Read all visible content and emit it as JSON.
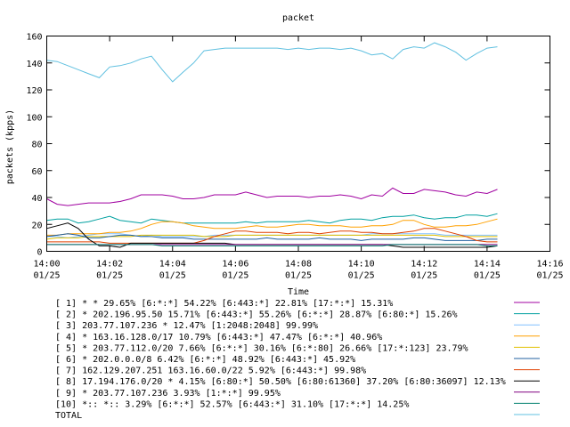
{
  "chart_data": {
    "type": "line",
    "title": "packet",
    "xlabel": "Time",
    "ylabel": "packets (kpps)",
    "ylim": [
      0,
      160
    ],
    "yticks": [
      0,
      20,
      40,
      60,
      80,
      100,
      120,
      140,
      160
    ],
    "xlim": [
      "14:00",
      "14:16"
    ],
    "xticks": [
      {
        "time": "14:00",
        "date": "01/25"
      },
      {
        "time": "14:02",
        "date": "01/25"
      },
      {
        "time": "14:04",
        "date": "01/25"
      },
      {
        "time": "14:06",
        "date": "01/25"
      },
      {
        "time": "14:08",
        "date": "01/25"
      },
      {
        "time": "14:10",
        "date": "01/25"
      },
      {
        "time": "14:12",
        "date": "01/25"
      },
      {
        "time": "14:14",
        "date": "01/25"
      },
      {
        "time": "14:16",
        "date": "01/25"
      }
    ],
    "grid": false,
    "legend_position": "bottom",
    "x_minutes": [
      0.0,
      0.33,
      0.67,
      1.0,
      1.33,
      1.67,
      2.0,
      2.33,
      2.67,
      3.0,
      3.33,
      3.67,
      4.0,
      4.33,
      4.67,
      5.0,
      5.33,
      5.67,
      6.0,
      6.33,
      6.67,
      7.0,
      7.33,
      7.67,
      8.0,
      8.33,
      8.67,
      9.0,
      9.33,
      9.67,
      10.0,
      10.33,
      10.67,
      11.0,
      11.33,
      11.67,
      12.0,
      12.33,
      12.67,
      13.0,
      13.33,
      13.67,
      14.0,
      14.33
    ],
    "series": [
      {
        "name": "[ 1] * * 29.65%  [6:*:*] 54.22% [6:443:*] 22.81% [17:*:*] 15.31%",
        "color": "#a000a0",
        "values": [
          39,
          35,
          34,
          35,
          36,
          36,
          36,
          37,
          39,
          42,
          42,
          42,
          41,
          39,
          39,
          40,
          42,
          42,
          42,
          44,
          42,
          40,
          41,
          41,
          41,
          40,
          41,
          41,
          42,
          41,
          39,
          42,
          41,
          47,
          43,
          43,
          46,
          45,
          44,
          42,
          41,
          44,
          43,
          46
        ]
      },
      {
        "name": "[ 2] * 202.196.95.50 15.71%  [6:443:*] 55.26% [6:*:*] 28.87% [6:80:*] 15.26%",
        "color": "#00a0a0",
        "values": [
          23,
          24,
          24,
          21,
          22,
          24,
          26,
          23,
          22,
          21,
          24,
          23,
          22,
          21,
          21,
          21,
          21,
          21,
          21,
          22,
          21,
          22,
          22,
          22,
          22,
          23,
          22,
          21,
          23,
          24,
          24,
          23,
          25,
          26,
          26,
          27,
          25,
          24,
          25,
          25,
          27,
          27,
          26,
          28
        ]
      },
      {
        "name": "[ 3] 203.77.107.236 * 12.47%  [1:2048:2048] 99.99%",
        "color": "#80c0ff",
        "values": [
          11,
          11,
          10,
          11,
          12,
          13,
          13,
          13,
          12,
          11,
          12,
          11,
          11,
          11,
          11,
          11,
          12,
          12,
          12,
          12,
          12,
          12,
          12,
          12,
          12,
          12,
          12,
          12,
          12,
          12,
          12,
          13,
          13,
          13,
          13,
          13,
          13,
          13,
          12,
          12,
          12,
          12,
          12,
          12
        ]
      },
      {
        "name": "[ 4] * 163.16.128.0/17 10.79%  [6:443:*] 47.47% [6:*:*] 40.96%",
        "color": "#ffa000",
        "values": [
          12,
          12,
          13,
          13,
          13,
          13,
          14,
          14,
          15,
          17,
          20,
          22,
          22,
          21,
          19,
          18,
          17,
          17,
          17,
          18,
          19,
          18,
          18,
          19,
          20,
          20,
          19,
          19,
          19,
          18,
          18,
          19,
          19,
          20,
          23,
          23,
          20,
          18,
          18,
          19,
          19,
          20,
          22,
          24
        ]
      },
      {
        "name": "[ 5] * 203.77.112.0/20 7.66%  [6:*:*] 30.16% [6:*:80] 26.66% [17:*:123] 23.79%",
        "color": "#e0c000",
        "values": [
          9,
          10,
          10,
          10,
          11,
          11,
          11,
          11,
          11,
          12,
          12,
          12,
          12,
          12,
          12,
          11,
          11,
          11,
          12,
          12,
          12,
          12,
          12,
          12,
          12,
          12,
          12,
          12,
          12,
          12,
          12,
          12,
          12,
          12,
          12,
          12,
          12,
          12,
          11,
          11,
          11,
          11,
          11,
          11
        ]
      },
      {
        "name": "[ 6] * 202.0.0.0/8 6.42%  [6:*:*] 48.92% [6:443:*] 45.92%",
        "color": "#2060a0",
        "values": [
          11,
          12,
          13,
          12,
          10,
          10,
          11,
          12,
          12,
          11,
          11,
          10,
          10,
          10,
          9,
          9,
          9,
          9,
          9,
          9,
          9,
          10,
          9,
          9,
          9,
          9,
          10,
          9,
          9,
          9,
          8,
          9,
          9,
          9,
          9,
          10,
          10,
          9,
          8,
          8,
          8,
          8,
          9,
          9
        ]
      },
      {
        "name": "[ 7] 162.129.207.251 163.16.60.0/22 5.92%  [6:443:*] 99.98%",
        "color": "#e04000",
        "values": [
          7,
          7,
          7,
          7,
          7,
          7,
          6,
          6,
          6,
          6,
          6,
          6,
          6,
          6,
          6,
          8,
          11,
          13,
          15,
          15,
          14,
          14,
          14,
          13,
          14,
          14,
          13,
          14,
          15,
          15,
          14,
          14,
          13,
          13,
          14,
          15,
          17,
          17,
          15,
          13,
          11,
          8,
          7,
          7
        ]
      },
      {
        "name": "[ 8] 17.194.176.0/20 * 4.15%  [6:80:*] 50.50% [6:80:61360] 37.20% [6:80:36097] 12.13%",
        "color": "#000000",
        "values": [
          17,
          19,
          21,
          17,
          9,
          4,
          4,
          3,
          6,
          6,
          6,
          6,
          6,
          6,
          6,
          6,
          6,
          6,
          5,
          5,
          5,
          5,
          5,
          5,
          5,
          5,
          5,
          5,
          5,
          5,
          5,
          5,
          5,
          4,
          3,
          3,
          3,
          3,
          3,
          3,
          3,
          3,
          3,
          4
        ]
      },
      {
        "name": "[ 9] * 203.77.107.236 3.93%  [1:*:*] 99.95%",
        "color": "#800080",
        "values": [
          5,
          5,
          5,
          5,
          5,
          5,
          5,
          5,
          5,
          5,
          5,
          5,
          5,
          5,
          5,
          5,
          5,
          5,
          5,
          5,
          5,
          5,
          5,
          5,
          5,
          5,
          5,
          5,
          5,
          5,
          5,
          5,
          5,
          5,
          5,
          5,
          5,
          5,
          5,
          5,
          5,
          5,
          5,
          5
        ]
      },
      {
        "name": "[10] *:: *:: 3.29%  [6:*:*] 52.57% [6:443:*] 31.10% [17:*:*] 14.25%",
        "color": "#00806e",
        "values": [
          5,
          5,
          5,
          5,
          5,
          5,
          5,
          5,
          5,
          5,
          5,
          4,
          4,
          4,
          4,
          4,
          4,
          4,
          4,
          4,
          4,
          4,
          4,
          4,
          4,
          4,
          4,
          4,
          4,
          4,
          4,
          4,
          4,
          5,
          5,
          5,
          5,
          5,
          5,
          5,
          5,
          5,
          4,
          4
        ]
      },
      {
        "name": "TOTAL",
        "color": "#60c0e0",
        "values": [
          142,
          141,
          138,
          135,
          132,
          129,
          137,
          138,
          140,
          143,
          145,
          135,
          126,
          133,
          140,
          149,
          150,
          151,
          151,
          151,
          151,
          151,
          151,
          150,
          151,
          150,
          151,
          151,
          150,
          151,
          149,
          146,
          147,
          143,
          150,
          152,
          151,
          155,
          152,
          148,
          142,
          147,
          151,
          152
        ]
      }
    ]
  }
}
